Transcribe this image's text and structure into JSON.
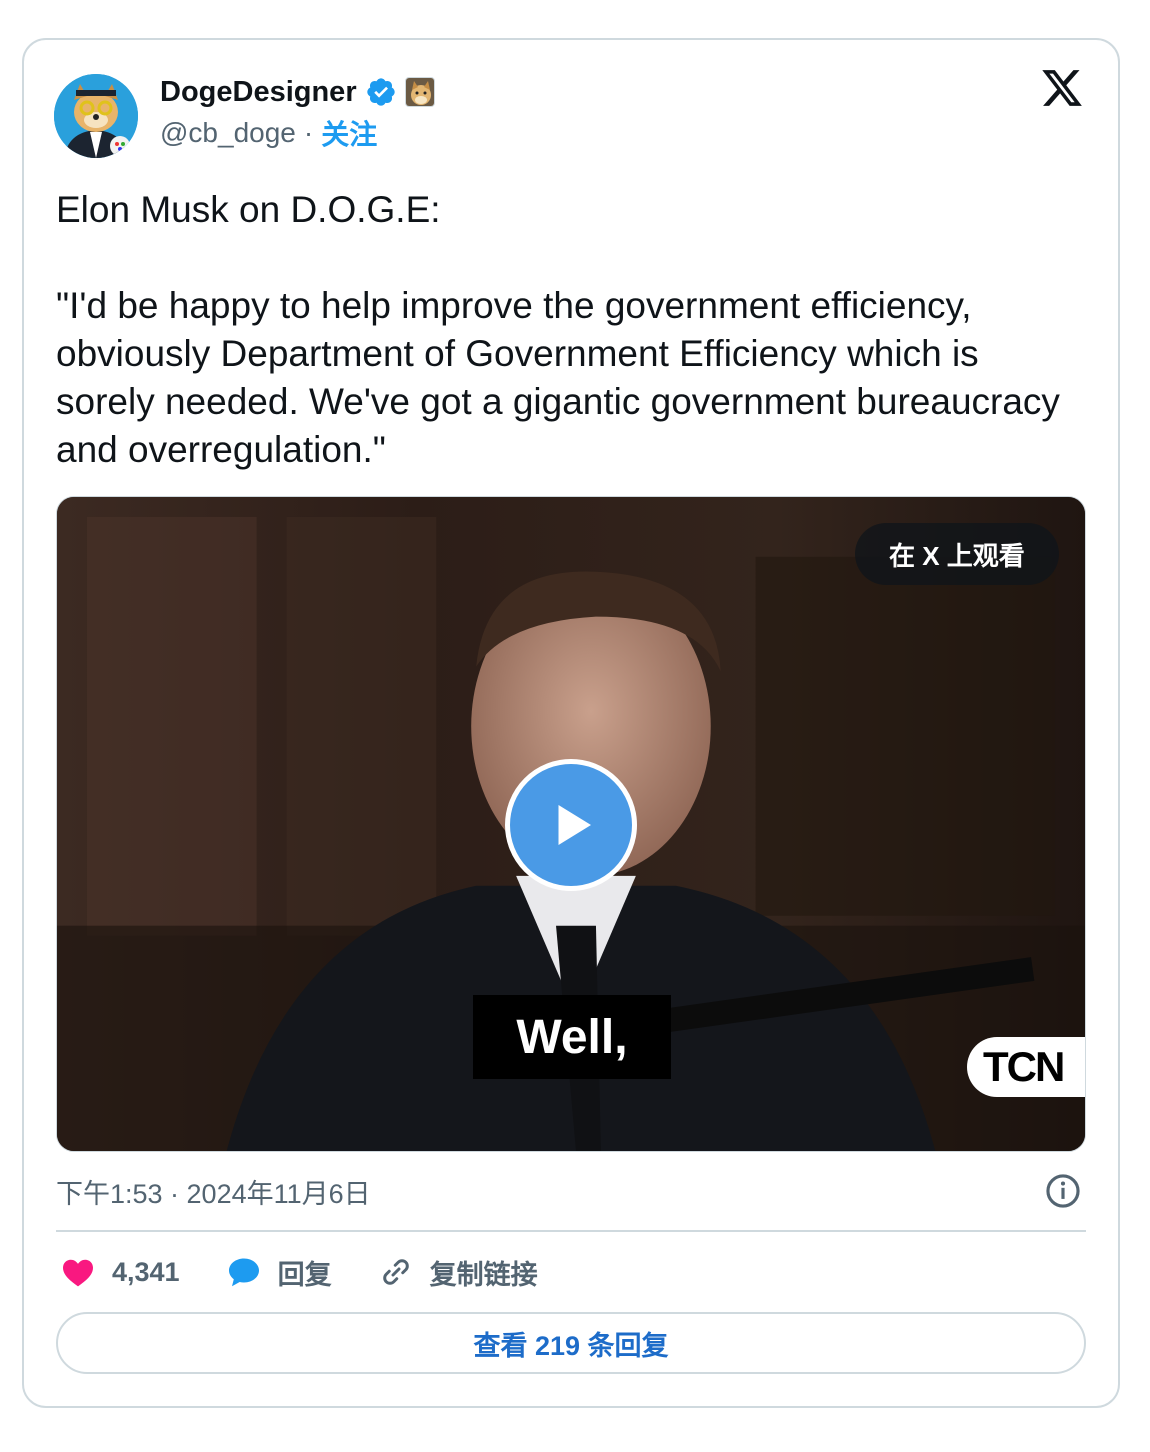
{
  "author": {
    "display_name": "DogeDesigner",
    "handle": "@cb_doge",
    "separator": "·",
    "follow_label": "关注",
    "verified_icon": "verified-badge-icon",
    "affiliate_icon": "doge-badge-icon"
  },
  "brand": {
    "logo": "x-logo-icon"
  },
  "tweet": {
    "text": "Elon Musk on D.O.G.E:\n\n\"I'd be happy to help improve the government efficiency, obviously Department of Government Efficiency which is sorely needed. We've got a gigantic government bureaucracy and overregulation.\""
  },
  "media": {
    "watch_on_x_label": "在 X 上观看",
    "caption": "Well,",
    "watermark": "TCN",
    "play_icon": "play-icon"
  },
  "meta": {
    "timestamp": "下午1:53 · 2024年11月6日",
    "info_icon": "info-icon"
  },
  "actions": {
    "like_count": "4,341",
    "reply_label": "回复",
    "copy_link_label": "复制链接"
  },
  "footer": {
    "view_replies_label": "查看 219 条回复"
  },
  "colors": {
    "accent": "#1d9bf0",
    "like": "#f91880",
    "border": "#cfd9de",
    "muted": "#536471"
  }
}
